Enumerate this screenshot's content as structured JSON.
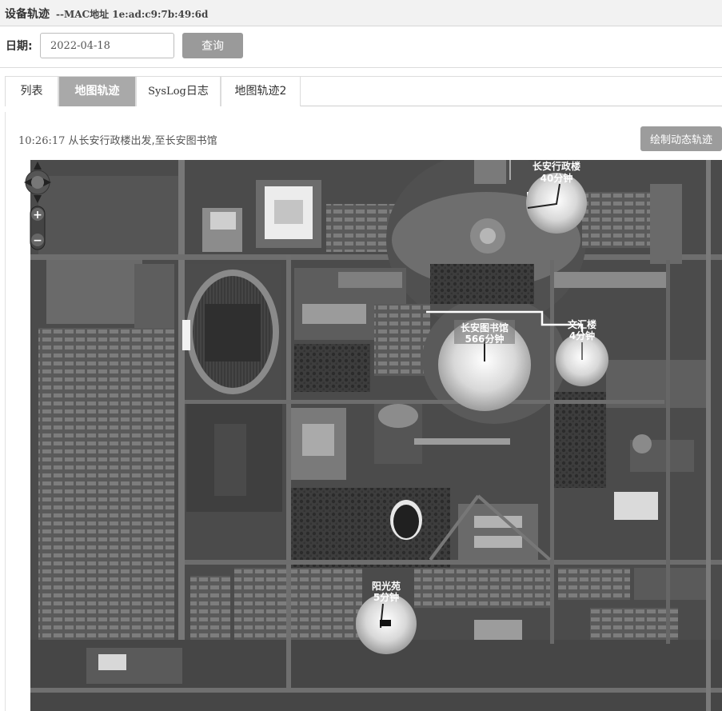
{
  "header": {
    "title": "设备轨迹",
    "mac_label": "--MAC地址  1e:ad:c9:7b:49:6d"
  },
  "query": {
    "date_label": "日期:",
    "date_value": "2022-04-18",
    "query_button": "查询"
  },
  "tabs": [
    {
      "label": "列表",
      "active": false
    },
    {
      "label": "地图轨迹",
      "active": true
    },
    {
      "label_a": "SysLog",
      "label_b": "日志",
      "active": false
    },
    {
      "label": "地图轨迹2",
      "active": false
    }
  ],
  "trajectory": {
    "time": "10:26:17",
    "description": "从长安行政楼出发,至长安图书馆",
    "draw_button": "绘制动态轨迹"
  },
  "map": {
    "zoom_in": "+",
    "zoom_out": "−",
    "markers": [
      {
        "name": "长安行政楼",
        "duration": "40分钟",
        "size": "medium"
      },
      {
        "name": "长安图书馆",
        "duration": "566分钟",
        "size": "large"
      },
      {
        "name": "文汇楼",
        "duration": "4分钟",
        "size": "small"
      },
      {
        "name": "阳光苑",
        "duration": "5分钟",
        "size": "small"
      }
    ]
  }
}
